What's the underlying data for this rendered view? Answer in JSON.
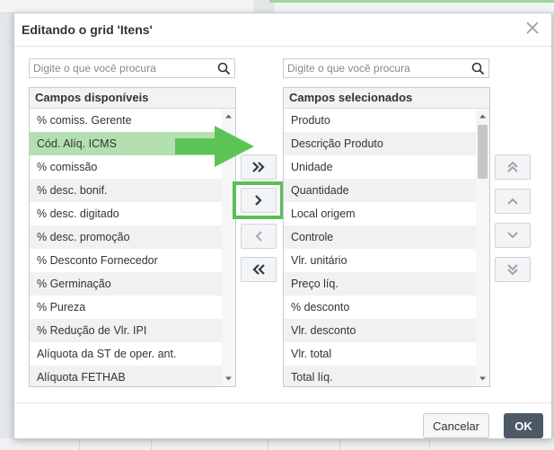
{
  "dialog": {
    "title": "Editando o grid 'Itens'"
  },
  "available": {
    "search_placeholder": "Digite o que você procura",
    "header": "Campos disponíveis",
    "items": [
      "% comiss. Gerente",
      "Cód. Alíq. ICMS",
      "% comissão",
      "% desc. bonif.",
      "% desc. digitado",
      "% desc. promoção",
      "% Desconto Fornecedor",
      "% Germinação",
      "% Pureza",
      "% Redução de Vlr. IPI",
      "Alíquota da ST de oper. ant.",
      "Alíquota FETHAB"
    ],
    "selected_index": 1
  },
  "selected": {
    "search_placeholder": "Digite o que você procura",
    "header": "Campos selecionados",
    "items": [
      "Produto",
      "Descrição Produto",
      "Unidade",
      "Quantidade",
      "Local origem",
      "Controle",
      "Vlr. unitário",
      "Preço líq.",
      "% desconto",
      "Vlr. desconto",
      "Vlr. total",
      "Total líq."
    ]
  },
  "buttons": {
    "cancel": "Cancelar",
    "ok": "OK"
  },
  "colors": {
    "highlight_green": "#59c152",
    "selected_row": "#b4e0b1",
    "ok_button": "#4d5a66"
  },
  "icons": {
    "move_all_right": "double-chevron-right-icon",
    "move_right": "chevron-right-icon",
    "move_left": "chevron-left-icon",
    "move_all_left": "double-chevron-left-icon",
    "move_top": "double-chevron-up-icon",
    "move_up": "chevron-up-icon",
    "move_down": "chevron-down-icon",
    "move_bottom": "double-chevron-down-icon"
  }
}
